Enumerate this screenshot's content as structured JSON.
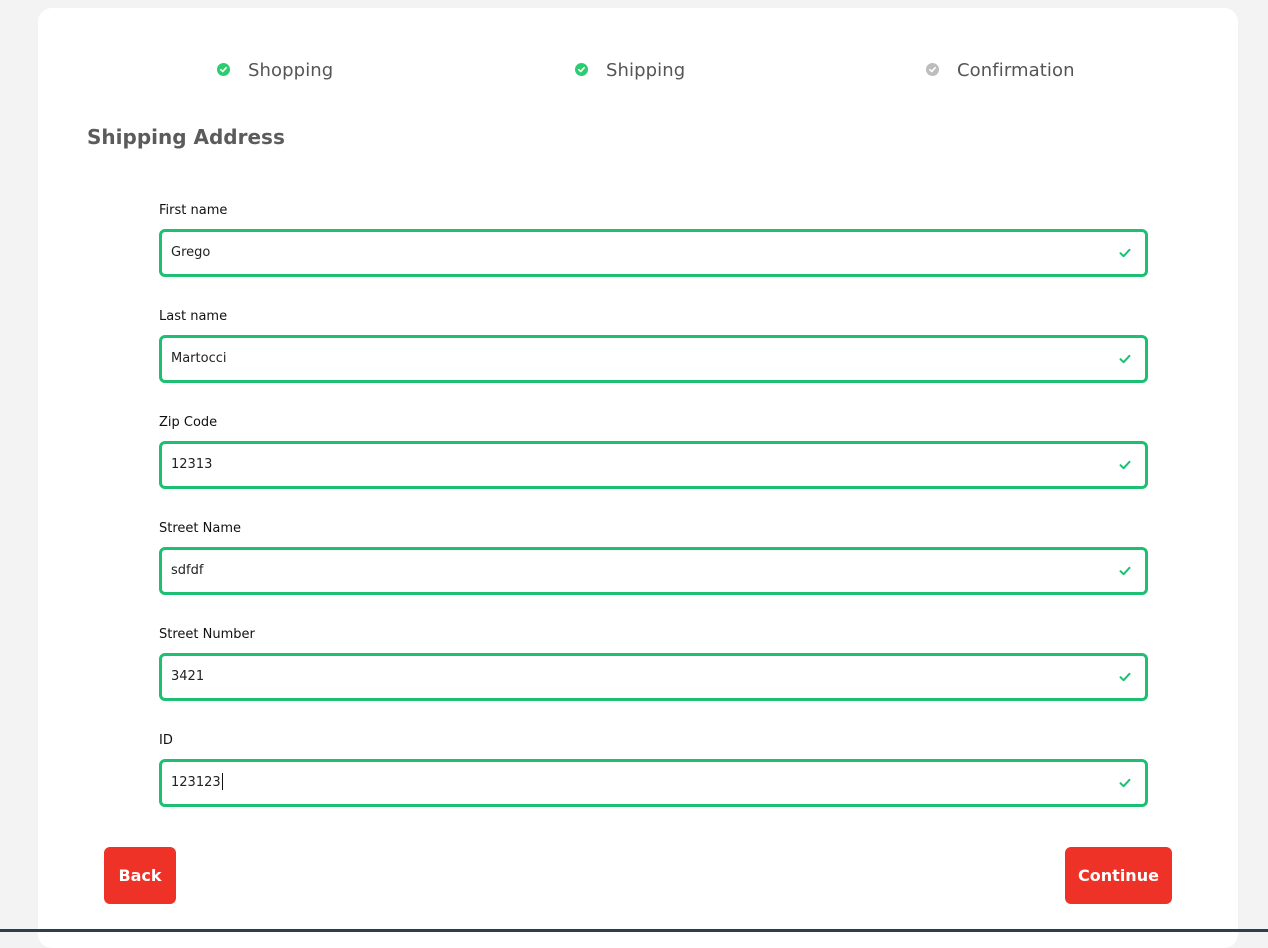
{
  "steps": [
    {
      "label": "Shopping",
      "status": "complete",
      "color": "#2ecc71"
    },
    {
      "label": "Shipping",
      "status": "complete",
      "color": "#2ecc71"
    },
    {
      "label": "Confirmation",
      "status": "pending",
      "color": "#bdbdbd"
    }
  ],
  "section_title": "Shipping Address",
  "fields": {
    "first_name": {
      "label": "First name",
      "value": "Grego"
    },
    "last_name": {
      "label": "Last name",
      "value": "Martocci"
    },
    "zip_code": {
      "label": "Zip Code",
      "value": "12313"
    },
    "street_name": {
      "label": "Street Name",
      "value": "sdfdf"
    },
    "street_number": {
      "label": "Street Number",
      "value": "3421"
    },
    "id": {
      "label": "ID",
      "value": "123123"
    }
  },
  "buttons": {
    "back": "Back",
    "continue": "Continue"
  },
  "colors": {
    "accent": "#ee3228",
    "valid": "#1dbf73",
    "background": "#f3f3f3"
  }
}
